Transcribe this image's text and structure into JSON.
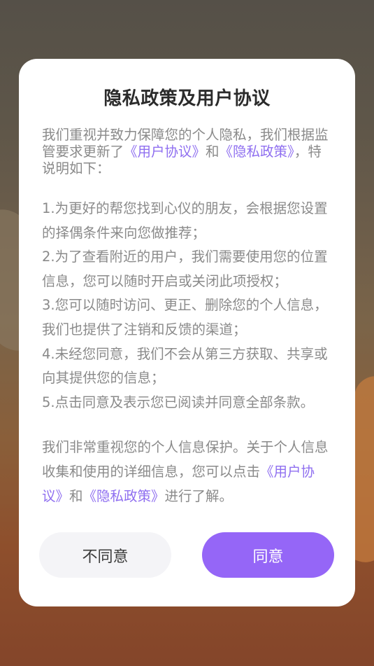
{
  "dialog": {
    "title": "隐私政策及用户协议",
    "intro": {
      "prefix": "我们重视并致力保障您的个人隐私，我们根据监管要求更新了",
      "link_user_agreement": "《用户协议》",
      "middle": "和",
      "link_privacy_policy": "《隐私政策》",
      "suffix": "，特说明如下："
    },
    "terms": [
      "1.为更好的帮您找到心仪的朋友，会根据您设置的择偶条件来向您做推荐；",
      "2.为了查看附近的用户，我们需要使用您的位置信息，您可以随时开启或关闭此项授权；",
      "3.您可以随时访问、更正、删除您的个人信息，我们也提供了注销和反馈的渠道；",
      "4.未经您同意，我们不会从第三方获取、共享或向其提供您的信息；",
      "5.点击同意及表示您已阅读并同意全部条款。"
    ],
    "outro": {
      "prefix": "我们非常重视您的个人信息保护。关于个人信息收集和使用的详细信息，您可以点击",
      "link_user_agreement": "《用户协议》",
      "middle": "和",
      "link_privacy_policy": "《隐私政策》",
      "suffix": "进行了解。"
    },
    "buttons": {
      "disagree_label": "不同意",
      "agree_label": "同意"
    }
  },
  "colors": {
    "accent": "#9566f7",
    "link": "#8f6ff0",
    "body_text": "#8a8a8a",
    "title_text": "#2b2b2b",
    "secondary_button_bg": "#f4f4f7"
  }
}
